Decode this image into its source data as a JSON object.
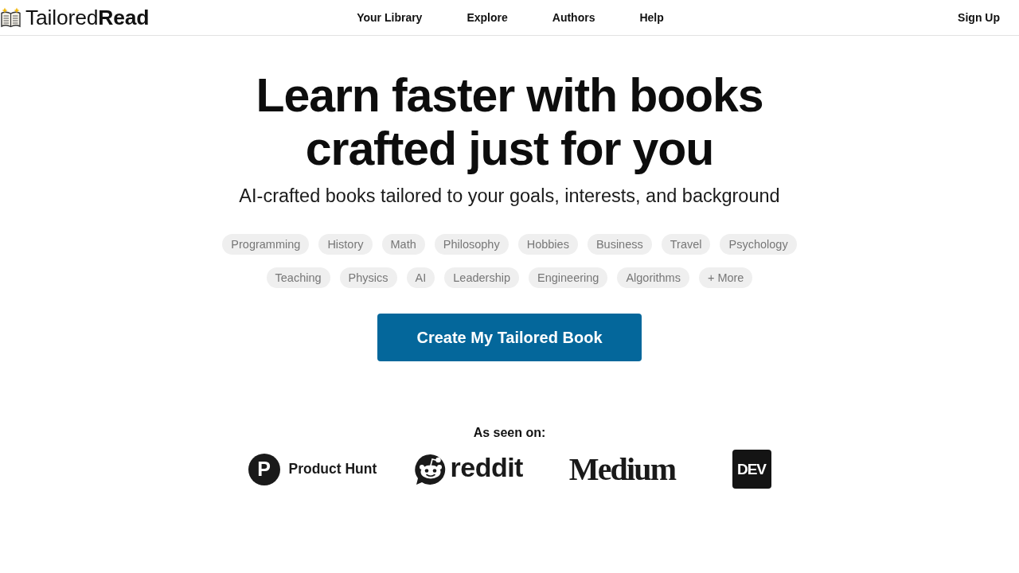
{
  "header": {
    "brand": "Tailored**Read**",
    "nav": [
      "Your Library",
      "Explore",
      "Authors",
      "Help"
    ],
    "sign_up": "Sign Up"
  },
  "hero": {
    "title": "Learn faster with books crafted just for you",
    "subtitle": "AI-crafted books tailored to your goals, interests, and background",
    "topic_rows": [
      [
        "Programming",
        "History",
        "Math",
        "Philosophy",
        "Hobbies",
        "Business",
        "Travel",
        "Psychology"
      ],
      [
        "Teaching",
        "Physics",
        "AI",
        "Leadership",
        "Engineering",
        "Algorithms",
        "+ More"
      ]
    ],
    "cta": "Create My Tailored Book"
  },
  "press": {
    "heading": "As seen on:",
    "outlets": [
      {
        "kind": "producthunt",
        "mark": "P",
        "name": "Product Hunt"
      },
      {
        "kind": "reddit",
        "name": "reddit"
      },
      {
        "kind": "medium",
        "name": "Medium"
      },
      {
        "kind": "dev",
        "name": "DEV"
      }
    ]
  }
}
